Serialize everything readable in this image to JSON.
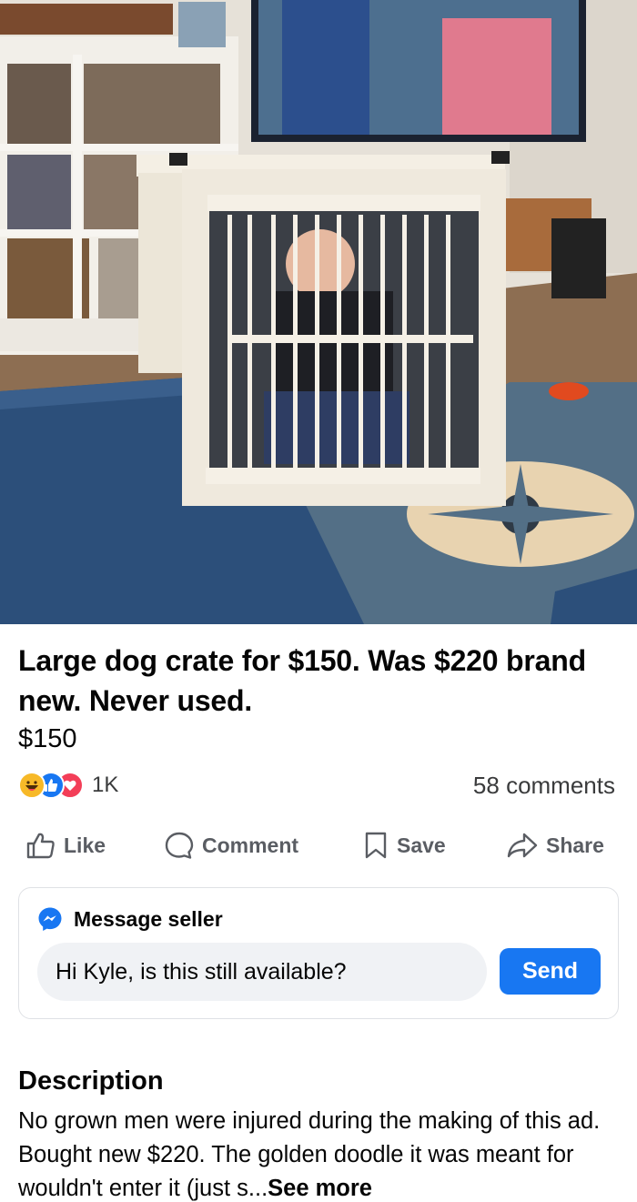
{
  "listing": {
    "title": "Large dog crate for $150. Was $220 brand new. Never used.",
    "price": "$150"
  },
  "engagement": {
    "reaction_icons": [
      "haha-icon",
      "like-icon",
      "love-icon"
    ],
    "reaction_count": "1K",
    "comments": "58 comments"
  },
  "actions": {
    "like": "Like",
    "comment": "Comment",
    "save": "Save",
    "share": "Share"
  },
  "message": {
    "heading": "Message seller",
    "input_value": "Hi Kyle, is this still available?",
    "send": "Send"
  },
  "description": {
    "heading": "Description",
    "text": "No grown men were injured during the making of this ad. Bought new $220. The golden doodle it was meant for wouldn't enter it (just s...",
    "see_more": "See more"
  },
  "colors": {
    "brand_blue": "#1877f2",
    "text_primary": "#050505",
    "text_secondary": "#5a5d63",
    "input_bg": "#f0f2f5"
  }
}
